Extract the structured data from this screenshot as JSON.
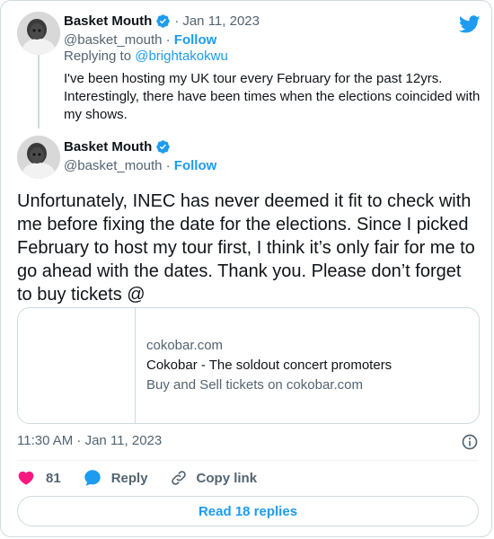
{
  "reply_tweet": {
    "author_name": "Basket Mouth",
    "separator": "·",
    "date": "Jan 11, 2023",
    "handle": "@basket_mouth",
    "follow_label": "Follow",
    "replying_prefix": "Replying to",
    "replying_to": "@brightakokwu",
    "text": "I've been hosting my UK tour every February for the past 12yrs. Interestingly, there have been times when the elections coincided with my shows."
  },
  "main_tweet": {
    "author_name": "Basket Mouth",
    "handle": "@basket_mouth",
    "separator": "·",
    "follow_label": "Follow",
    "text": "Unfortunately, INEC has never deemed it fit to check with me before fixing the date for the elections. Since I picked February to host my tour first, I think it’s only fair for me to go ahead with the dates. Thank you. Please don’t forget to buy tickets @",
    "link_card": {
      "domain": "cokobar.com",
      "title": "Cokobar - The soldout concert promoters",
      "description": "Buy and Sell tickets on cokobar.com"
    },
    "timestamp": "11:30 AM · Jan 11, 2023",
    "like_count": "81",
    "reply_label": "Reply",
    "copy_link_label": "Copy link",
    "read_replies_label": "Read 18 replies"
  },
  "icons": {
    "brand": "twitter-bird-icon",
    "verified": "verified-badge-icon",
    "like": "heart-icon",
    "reply": "speech-bubble-icon",
    "copy": "link-icon",
    "info": "info-icon"
  },
  "colors": {
    "accent": "#1d9bf0",
    "like": "#f91880",
    "text": "#0f1419",
    "muted": "#536471",
    "border": "#cfd9de"
  }
}
